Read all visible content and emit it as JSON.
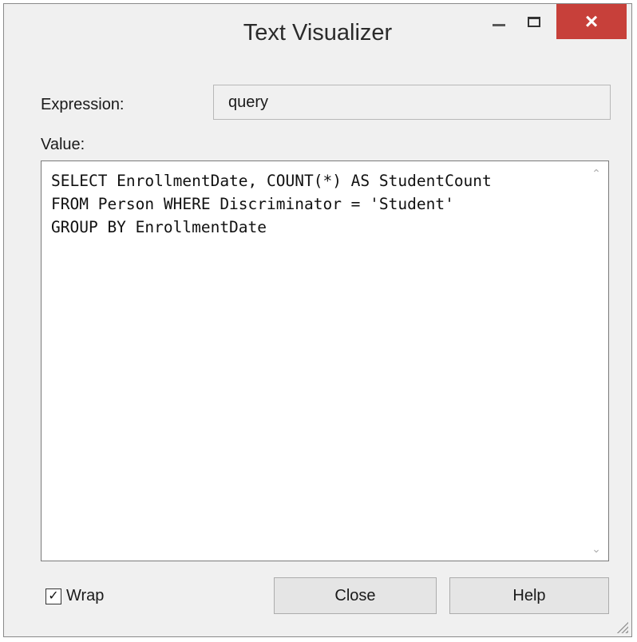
{
  "window": {
    "title": "Text Visualizer",
    "close_glyph": "×",
    "accent_close": "#c7403a"
  },
  "expression": {
    "label": "Expression:",
    "value": "query"
  },
  "value": {
    "label": "Value:",
    "text": "SELECT EnrollmentDate, COUNT(*) AS StudentCount\nFROM Person WHERE Discriminator = 'Student'\nGROUP BY EnrollmentDate"
  },
  "wrap": {
    "label": "Wrap",
    "checked": true,
    "check_glyph": "✓"
  },
  "buttons": {
    "close": "Close",
    "help": "Help"
  }
}
